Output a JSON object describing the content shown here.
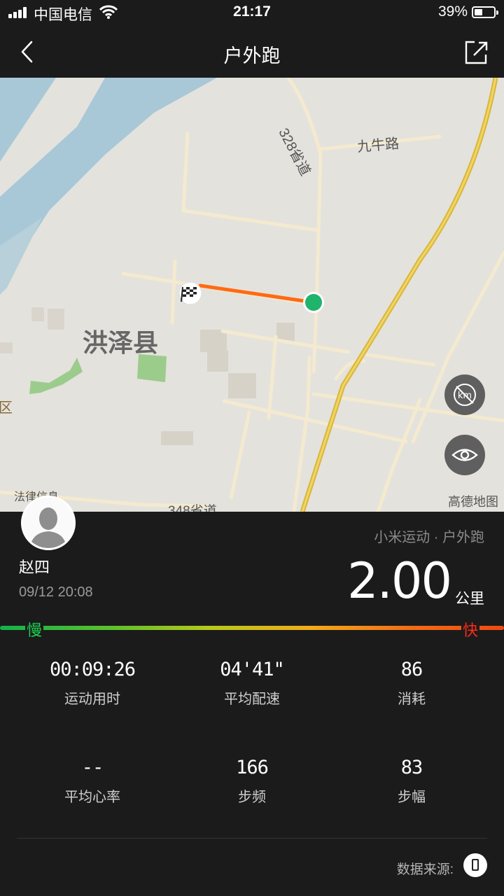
{
  "status_bar": {
    "carrier": "中国电信",
    "time": "21:17",
    "battery": "39%",
    "battery_level": 0.39
  },
  "header": {
    "title": "户外跑",
    "back_icon": "chevron-left-icon",
    "share_icon": "share-icon"
  },
  "map": {
    "labels": {
      "county": "洪泽县",
      "road_328": "328省道",
      "road_jiuniu": "九牛路",
      "road_348": "348省道",
      "district_fragment": "区",
      "poi_fragment": "法律信息"
    },
    "credit": "高德地图",
    "buttons": [
      "km-marker-toggle-icon",
      "eye-icon"
    ],
    "colors": {
      "route": "#ff6a12",
      "end_marker": "#1fb36b"
    }
  },
  "summary": {
    "user_name": "赵四",
    "datetime": "09/12 20:08",
    "source": "小米运动 · 户外跑",
    "distance": "2.00",
    "distance_unit": "公里"
  },
  "pace_legend": {
    "slow": "慢",
    "fast": "快"
  },
  "stats": [
    {
      "value": "00:09:26",
      "label": "运动用时"
    },
    {
      "value": "04'41\"",
      "label": "平均配速"
    },
    {
      "value": "86",
      "label": "消耗"
    },
    {
      "value": "--",
      "label": "平均心率"
    },
    {
      "value": "166",
      "label": "步频"
    },
    {
      "value": "83",
      "label": "步幅"
    }
  ],
  "footer": {
    "data_source_label": "数据来源:",
    "device_icon": "phone-device-icon"
  }
}
